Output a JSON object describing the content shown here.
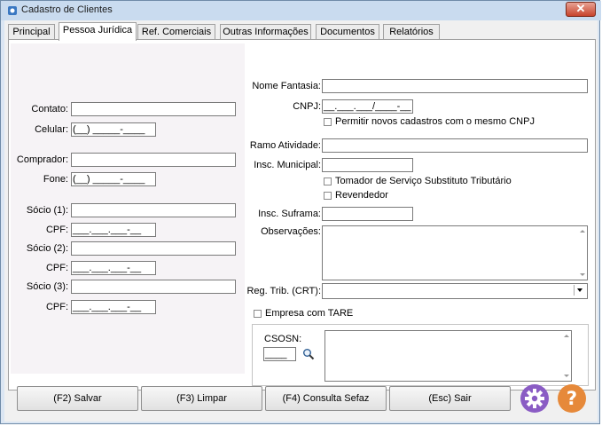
{
  "window": {
    "title": "Cadastro de Clientes",
    "close_glyph": "✕"
  },
  "tabs": [
    {
      "label": "Principal"
    },
    {
      "label": "Pessoa Jurídica"
    },
    {
      "label": "Ref. Comerciais"
    },
    {
      "label": "Outras Informações"
    },
    {
      "label": "Documentos"
    },
    {
      "label": "Relatórios"
    }
  ],
  "active_tab": "Pessoa Jurídica",
  "left": {
    "contato": {
      "label": "Contato:",
      "value": ""
    },
    "celular": {
      "label": "Celular:",
      "value": "(__) _____-____"
    },
    "comprador": {
      "label": "Comprador:",
      "value": ""
    },
    "fone": {
      "label": "Fone:",
      "value": "(__) _____-____"
    },
    "socio1": {
      "label": "Sócio (1):",
      "value": ""
    },
    "cpf1": {
      "label": "CPF:",
      "value": "___.___.___-__"
    },
    "socio2": {
      "label": "Sócio (2):",
      "value": ""
    },
    "cpf2": {
      "label": "CPF:",
      "value": "___.___.___-__"
    },
    "socio3": {
      "label": "Sócio (3):",
      "value": ""
    },
    "cpf3": {
      "label": "CPF:",
      "value": "___.___.___-__"
    }
  },
  "right": {
    "nome_fantasia": {
      "label": "Nome Fantasia:",
      "value": ""
    },
    "cnpj": {
      "label": "CNPJ:",
      "value": "__.___.___/____-__"
    },
    "permitir_cnpj": {
      "label": "Permitir novos cadastros com o mesmo CNPJ",
      "checked": false
    },
    "ramo": {
      "label": "Ramo Atividade:",
      "value": ""
    },
    "insc_municipal": {
      "label": "Insc. Municipal:",
      "value": ""
    },
    "tomador": {
      "label": "Tomador de Serviço Substituto Tributário",
      "checked": false
    },
    "revendedor": {
      "label": "Revendedor",
      "checked": false
    },
    "insc_suframa": {
      "label": "Insc. Suframa:",
      "value": ""
    },
    "observacoes": {
      "label": "Observações:",
      "value": ""
    },
    "reg_trib": {
      "label": "Reg. Trib. (CRT):",
      "value": ""
    },
    "tare": {
      "label": "Empresa com TARE",
      "checked": false
    },
    "csosn": {
      "label": "CSOSN:",
      "value": "____",
      "description": ""
    }
  },
  "buttons": {
    "salvar": "(F2) Salvar",
    "limpar": "(F3) Limpar",
    "sefaz": "(F4) Consulta Sefaz",
    "sair": "(Esc) Sair"
  },
  "colors": {
    "settings_icon": "#8a5cc4",
    "help_icon": "#e6893a"
  }
}
